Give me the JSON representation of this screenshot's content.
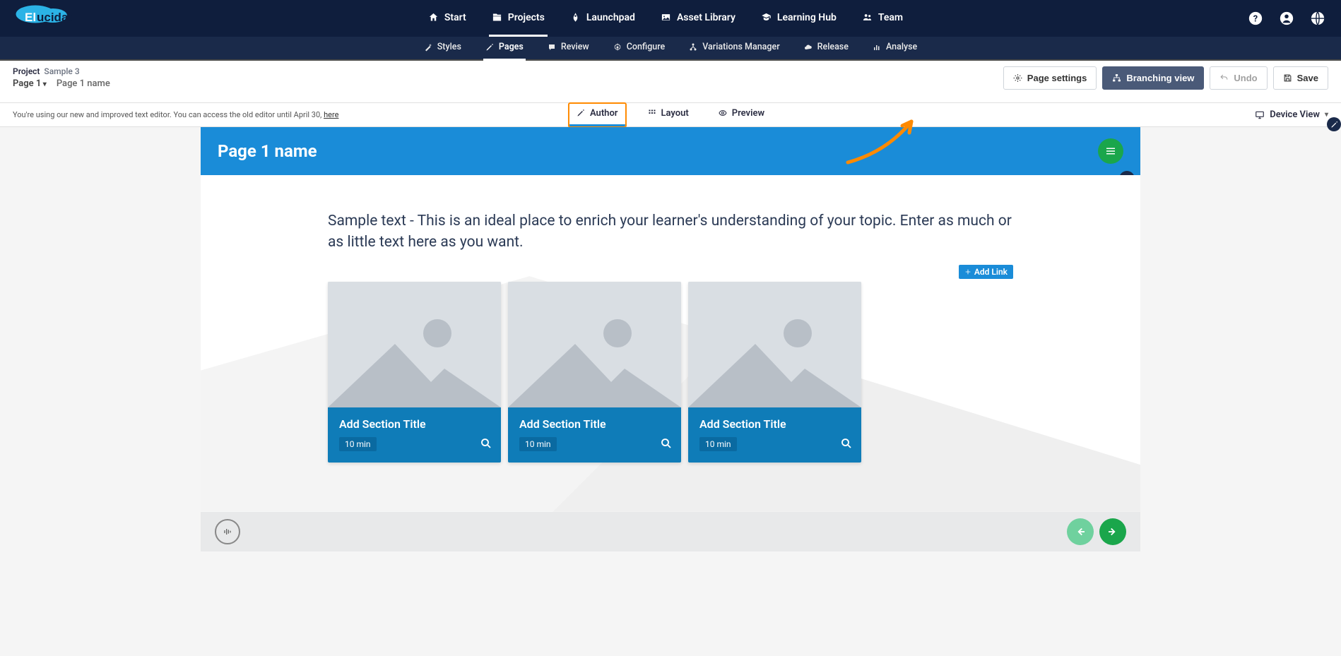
{
  "brand": {
    "name": "Elucidat"
  },
  "topnav": {
    "items": [
      {
        "label": "Start",
        "icon": "home-icon"
      },
      {
        "label": "Projects",
        "icon": "projects-icon",
        "active": true
      },
      {
        "label": "Launchpad",
        "icon": "launchpad-icon"
      },
      {
        "label": "Asset Library",
        "icon": "asset-library-icon"
      },
      {
        "label": "Learning Hub",
        "icon": "learning-hub-icon"
      },
      {
        "label": "Team",
        "icon": "team-icon"
      }
    ]
  },
  "subnav": {
    "items": [
      {
        "label": "Styles"
      },
      {
        "label": "Pages",
        "active": true
      },
      {
        "label": "Review"
      },
      {
        "label": "Configure"
      },
      {
        "label": "Variations Manager"
      },
      {
        "label": "Release"
      },
      {
        "label": "Analyse"
      }
    ]
  },
  "breadcrumb": {
    "project_label": "Project",
    "project_name": "Sample 3",
    "page_selector": "Page 1",
    "page_name": "Page 1 name"
  },
  "toolbar": {
    "page_settings": "Page settings",
    "branching_view": "Branching view",
    "undo": "Undo",
    "save": "Save"
  },
  "editor_notice": {
    "text": "You're using our new and improved text editor. You can access the old editor until April 30, ",
    "link": "here"
  },
  "mode_tabs": {
    "author": "Author",
    "layout": "Layout",
    "preview": "Preview"
  },
  "device_view_label": "Device View",
  "page": {
    "title": "Page 1 name",
    "intro": "Sample text - This is an ideal place to enrich your learner's understanding of your topic. Enter as much or as little text here as you want.",
    "add_link_label": "Add Link",
    "cards": [
      {
        "title": "Add Section Title",
        "duration": "10 min"
      },
      {
        "title": "Add Section Title",
        "duration": "10 min"
      },
      {
        "title": "Add Section Title",
        "duration": "10 min"
      }
    ]
  },
  "annotation": {
    "target": "branching-view-button",
    "color": "#ff8a00"
  }
}
